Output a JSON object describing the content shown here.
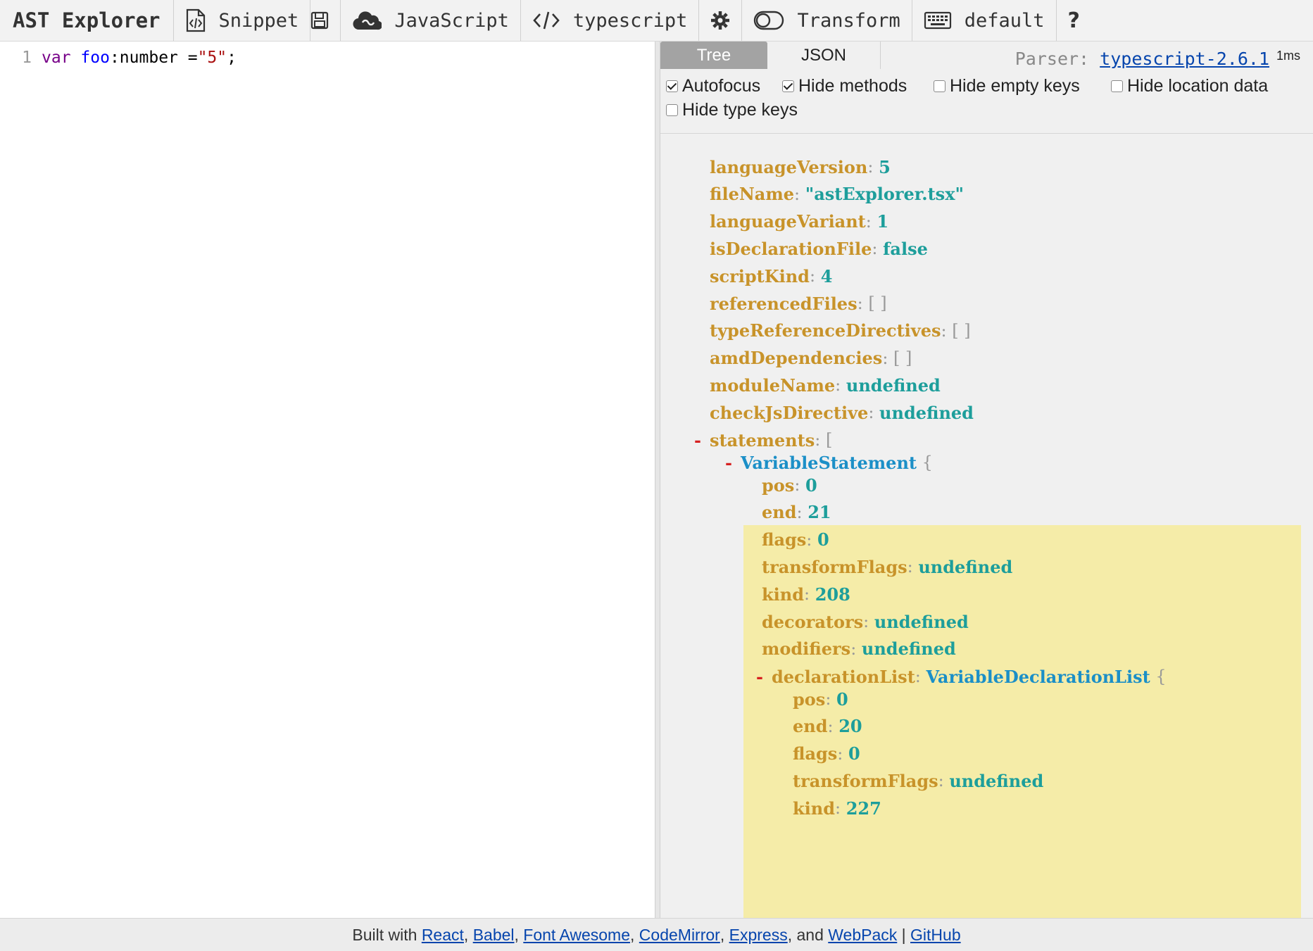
{
  "app": {
    "title": "AST Explorer"
  },
  "toolbar": {
    "snippet_label": "Snippet",
    "language_label": "JavaScript",
    "parser_label": "typescript",
    "transform_label": "Transform",
    "keymap_label": "default",
    "help_label": "?"
  },
  "editor": {
    "line_number": "1",
    "tokens": {
      "kw": "var",
      "def": "foo",
      "rest": ":number = ",
      "str": "\"5\"",
      "end": ";"
    }
  },
  "output": {
    "tabs": {
      "tree": "Tree",
      "json": "JSON"
    },
    "parser_prefix": "Parser:",
    "parser_link": "typescript-2.6.1",
    "timing": "1ms",
    "options": [
      {
        "label": "Autofocus",
        "checked": true
      },
      {
        "label": "Hide methods",
        "checked": true
      },
      {
        "label": "Hide empty keys",
        "checked": false
      },
      {
        "label": "Hide location data",
        "checked": false
      },
      {
        "label": "Hide type keys",
        "checked": false
      }
    ],
    "tree": {
      "rows": [
        {
          "key": "languageVersion",
          "value": "5"
        },
        {
          "key": "fileName",
          "value": "\"astExplorer.tsx\""
        },
        {
          "key": "languageVariant",
          "value": "1"
        },
        {
          "key": "isDeclarationFile",
          "value": "false"
        },
        {
          "key": "scriptKind",
          "value": "4"
        },
        {
          "key": "referencedFiles",
          "value": "[ ]"
        },
        {
          "key": "typeReferenceDirectives",
          "value": "[ ]"
        },
        {
          "key": "amdDependencies",
          "value": "[ ]"
        },
        {
          "key": "moduleName",
          "value": "undefined"
        },
        {
          "key": "checkJsDirective",
          "value": "undefined"
        }
      ],
      "statements_key": "statements",
      "statements_open": "[",
      "toggle": "-",
      "var_stmt_type": "VariableStatement",
      "brace_open": "{",
      "var_stmt_rows": [
        {
          "key": "pos",
          "value": "0"
        },
        {
          "key": "end",
          "value": "21"
        },
        {
          "key": "flags",
          "value": "0"
        },
        {
          "key": "transformFlags",
          "value": "undefined"
        },
        {
          "key": "kind",
          "value": "208"
        },
        {
          "key": "decorators",
          "value": "undefined"
        },
        {
          "key": "modifiers",
          "value": "undefined"
        }
      ],
      "decl_list_key": "declarationList",
      "decl_list_type": "VariableDeclarationList",
      "decl_list_rows": [
        {
          "key": "pos",
          "value": "0"
        },
        {
          "key": "end",
          "value": "20"
        },
        {
          "key": "flags",
          "value": "0"
        },
        {
          "key": "transformFlags",
          "value": "undefined"
        },
        {
          "key": "kind",
          "value": "227"
        }
      ]
    }
  },
  "footer": {
    "built_with": "Built with",
    "links": [
      "React",
      "Babel",
      "Font Awesome",
      "CodeMirror",
      "Express",
      "WebPack"
    ],
    "and": "and",
    "github": "GitHub"
  }
}
